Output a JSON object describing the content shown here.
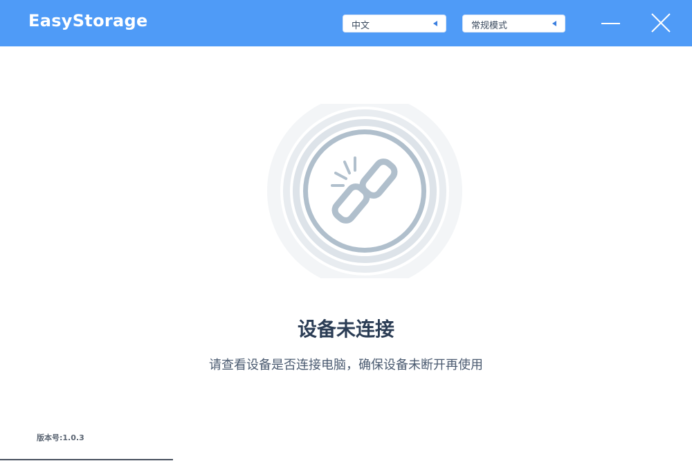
{
  "window": {
    "title": "EasyStorage"
  },
  "titlebar": {
    "language_select": {
      "value": "中文"
    },
    "mode_select": {
      "value": "常规模式"
    },
    "minimize_icon": "minimize-icon",
    "close_icon": "close-icon"
  },
  "main": {
    "illustration_icon": "broken-link-icon",
    "status_title": "设备未连接",
    "status_message": "请查看设备是否连接电脑，确保设备未断开再使用"
  },
  "footer": {
    "version": "版本号:1.0.3"
  },
  "colors": {
    "titlebar": "#4f9bf7",
    "accent": "#3a7fe0",
    "icon": "#b0bfcc",
    "title_text": "#2b3d55"
  }
}
